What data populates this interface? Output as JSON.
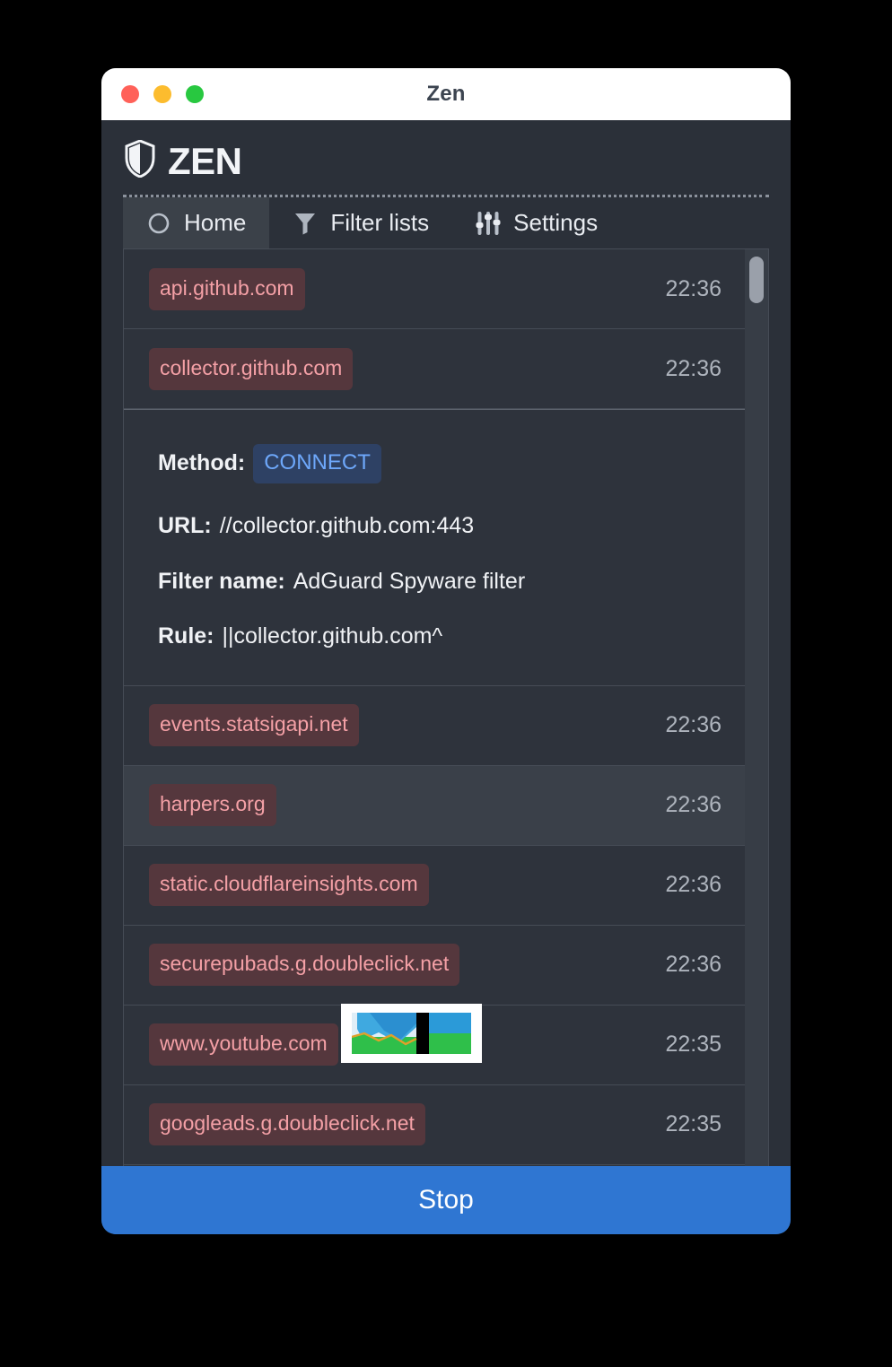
{
  "window": {
    "title": "Zen",
    "traffic_lights": [
      {
        "name": "close",
        "color": "#ff6159"
      },
      {
        "name": "minimize",
        "color": "#fcbc2e"
      },
      {
        "name": "maximize",
        "color": "#28c840"
      }
    ]
  },
  "brand": {
    "name": "ZEN",
    "icon": "shield-icon"
  },
  "tabs": [
    {
      "label": "Home",
      "icon": "circle-icon",
      "active": true
    },
    {
      "label": "Filter lists",
      "icon": "funnel-icon",
      "active": false
    },
    {
      "label": "Settings",
      "icon": "sliders-icon",
      "active": false
    }
  ],
  "list": [
    {
      "domain": "api.github.com",
      "time": "22:36",
      "hover": false
    },
    {
      "domain": "collector.github.com",
      "time": "22:36",
      "hover": false
    },
    {
      "domain": "events.statsigapi.net",
      "time": "22:36",
      "hover": false
    },
    {
      "domain": "harpers.org",
      "time": "22:36",
      "hover": true
    },
    {
      "domain": "static.cloudflareinsights.com",
      "time": "22:36",
      "hover": false
    },
    {
      "domain": "securepubads.g.doubleclick.net",
      "time": "22:36",
      "hover": false
    },
    {
      "domain": "www.youtube.com",
      "time": "22:35",
      "hover": false
    },
    {
      "domain": "googleads.g.doubleclick.net",
      "time": "22:35",
      "hover": false
    }
  ],
  "detail": {
    "method_label": "Method:",
    "method_value": "CONNECT",
    "url_label": "URL:",
    "url_value": "//collector.github.com:443",
    "filter_name_label": "Filter name:",
    "filter_name_value": "AdGuard Spyware filter",
    "rule_label": "Rule:",
    "rule_value": "||collector.github.com^"
  },
  "footer": {
    "stop_label": "Stop"
  },
  "colors": {
    "accent": "#2f76d2",
    "badge_bg": "#55373d",
    "badge_text": "#f4a0a6",
    "method_bg": "#2e4164",
    "method_text": "#6ea8fb",
    "panel_bg": "#2e333c",
    "app_bg": "#2b3039"
  }
}
